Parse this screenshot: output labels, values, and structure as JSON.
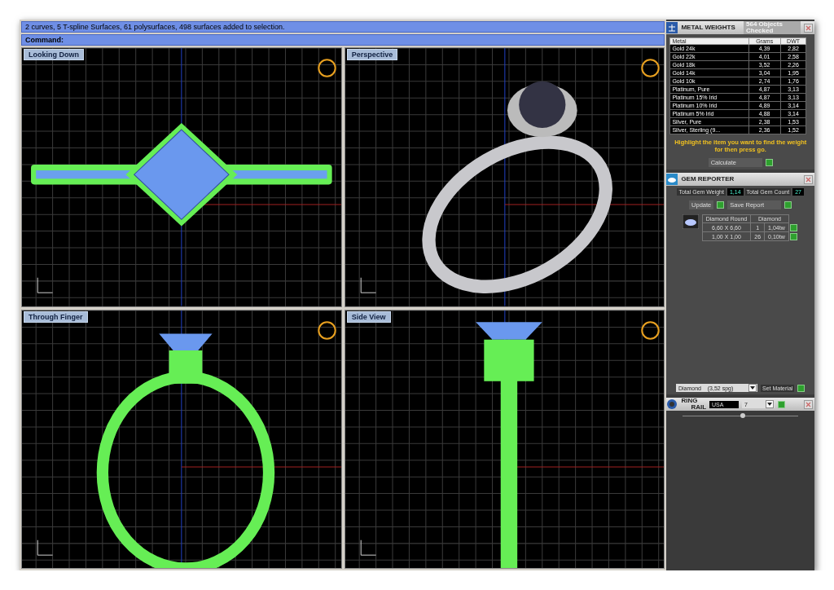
{
  "command_bar": {
    "history": "2 curves, 5 T-spline Surfaces, 61 polysurfaces, 498 surfaces added to selection.",
    "prompt": "Command:"
  },
  "viewports": [
    {
      "label": "Looking Down",
      "kind": "top"
    },
    {
      "label": "Perspective",
      "kind": "perspective"
    },
    {
      "label": "Through Finger",
      "kind": "front"
    },
    {
      "label": "Side View",
      "kind": "side"
    }
  ],
  "metal_weights": {
    "title": "METAL WEIGHTS",
    "status": "564 Objects Checked",
    "columns": [
      "Metal",
      "Grams",
      "DWT"
    ],
    "rows": [
      [
        "Gold 24k",
        "4,39",
        "2,82"
      ],
      [
        "Gold 22k",
        "4,01",
        "2,58"
      ],
      [
        "Gold 18k",
        "3,52",
        "2,26"
      ],
      [
        "Gold 14k",
        "3,04",
        "1,95"
      ],
      [
        "Gold 10k",
        "2,74",
        "1,76"
      ],
      [
        "Platinum, Pure",
        "4,87",
        "3,13"
      ],
      [
        "Platinum 15% Irid",
        "4,87",
        "3,13"
      ],
      [
        "Platinum 10% Irid",
        "4,89",
        "3,14"
      ],
      [
        "Platinum 5% Irid",
        "4,88",
        "3,14"
      ],
      [
        "Silver, Pure",
        "2,38",
        "1,53"
      ],
      [
        "Silver, Sterling (9...",
        "2,36",
        "1,52"
      ]
    ],
    "hint": "Highlight the item you want to find the weight for then press go.",
    "button": "Calculate"
  },
  "gem_reporter": {
    "title": "GEM REPORTER",
    "weight_label": "Total Gem Weight",
    "weight": "1,14",
    "count_label": "Total Gem Count",
    "count": "27",
    "update": "Update",
    "save": "Save Report",
    "header": [
      "Diamond Round",
      "Diamond"
    ],
    "rows": [
      [
        "6,60 X 6,60",
        "1",
        "1,04tw"
      ],
      [
        "1,00 X 1,00",
        "26",
        "0,10tw"
      ]
    ],
    "material": "Diamond    (3,52 spg)",
    "set_material": "Set Material"
  },
  "ring_rail": {
    "title_top": "RING",
    "title_bottom": "RAIL",
    "standard": "USA",
    "size": "7"
  }
}
